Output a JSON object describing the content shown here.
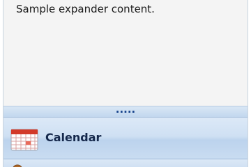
{
  "expander": {
    "content_text": "Sample expander content."
  },
  "splitter": {
    "grip_text": "....."
  },
  "nav": {
    "items": [
      {
        "label": "Calendar",
        "icon": "calendar-icon"
      },
      {
        "label": "",
        "icon": "contacts-icon"
      }
    ]
  },
  "colors": {
    "nav_text": "#15284b",
    "accent": "#15428b",
    "calendar_red": "#d23a2a"
  }
}
